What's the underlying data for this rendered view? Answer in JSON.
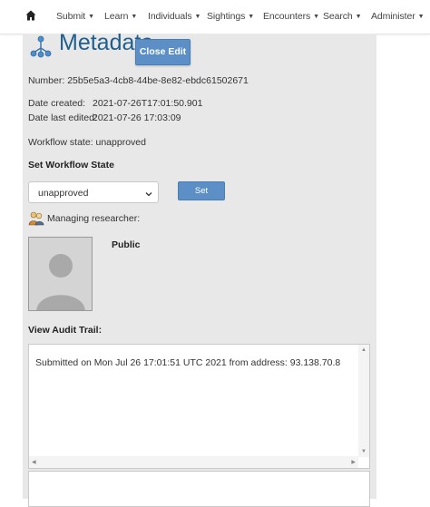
{
  "nav": {
    "items": [
      {
        "label": "Submit",
        "caret": "▼"
      },
      {
        "label": "Learn",
        "caret": "▼"
      },
      {
        "label": "Individuals",
        "caret": "▼"
      },
      {
        "label": "Sightings",
        "caret": "▼"
      },
      {
        "label": "Encounters",
        "caret": "▼"
      },
      {
        "label": "Search",
        "caret": "▼"
      },
      {
        "label": "Administer",
        "caret": "▼"
      }
    ]
  },
  "metadata": {
    "title": "Metadata",
    "close_edit_label": "Close Edit",
    "number_label": "Number:",
    "number_value": "25b5e5a3-4cb8-44be-8e82-ebdc61502671",
    "date_created_label": "Date created:",
    "date_created_value": "2021-07-26T17:01:50.901",
    "date_last_edited_label": "Date last edited:",
    "date_last_edited_value": "2021-07-26 17:03:09",
    "workflow_state_text": "Workflow state: unapproved"
  },
  "workflow": {
    "heading": "Set Workflow State",
    "selected": "unapproved",
    "set_label": "Set"
  },
  "researcher": {
    "label": "Managing researcher:",
    "name": "Public"
  },
  "audit": {
    "heading": "View Audit Trail:",
    "entry": "Submitted on Mon Jul 26 17:01:51 UTC 2021 from address: 93.138.70.8"
  },
  "colors": {
    "accent": "#5b8fc6",
    "title": "#1f5f8f",
    "panel_bg": "#e8e8e8"
  },
  "icons": [
    "home-icon",
    "metadata-tree-icon",
    "managing-researcher-icon",
    "chevron-down-icon"
  ]
}
